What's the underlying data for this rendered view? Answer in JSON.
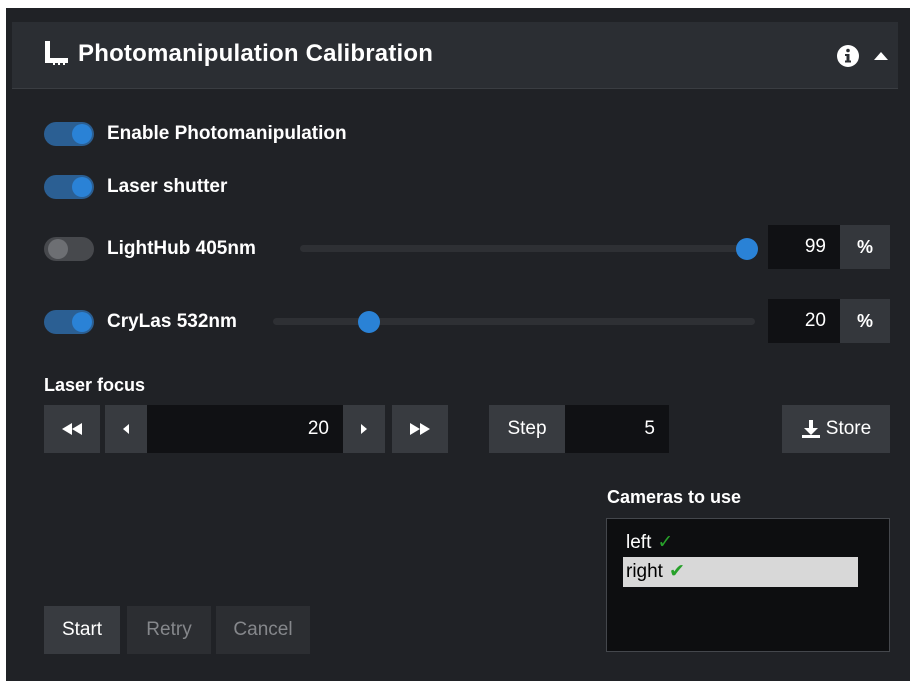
{
  "header": {
    "title": "Photomanipulation Calibration",
    "icon": "ruler-icon"
  },
  "toggles": {
    "enable_photomanipulation": {
      "label": "Enable Photomanipulation",
      "on": true
    },
    "laser_shutter": {
      "label": "Laser shutter",
      "on": true
    }
  },
  "lasers": [
    {
      "label": "LightHub 405nm",
      "on": false,
      "value": "99",
      "unit": "%",
      "level": 0.99
    },
    {
      "label": "CryLas 532nm",
      "on": true,
      "value": "20",
      "unit": "%",
      "level": 0.2
    }
  ],
  "laser_focus": {
    "label": "Laser focus",
    "value": "20",
    "step_label": "Step",
    "step_value": "5",
    "store_label": "Store"
  },
  "cameras": {
    "label": "Cameras to use",
    "items": [
      {
        "name": "left",
        "checked": true,
        "selected": false
      },
      {
        "name": "right",
        "checked": true,
        "selected": true
      }
    ]
  },
  "actions": {
    "start": "Start",
    "retry": "Retry",
    "cancel": "Cancel"
  },
  "colors": {
    "accent": "#2a82d6",
    "check": "#27a12a"
  }
}
